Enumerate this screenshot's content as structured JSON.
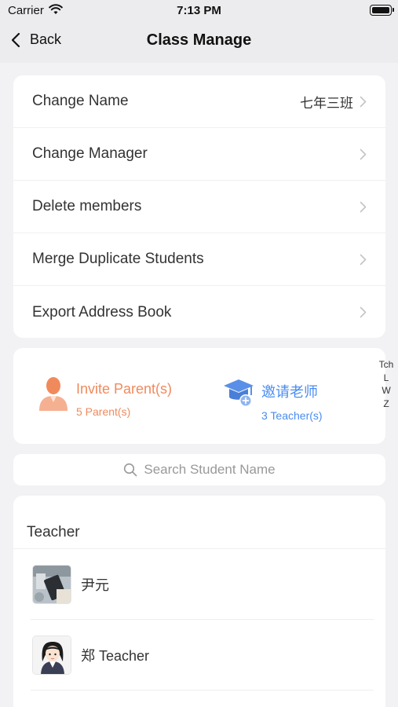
{
  "status_bar": {
    "carrier": "Carrier",
    "time": "7:13 PM"
  },
  "nav": {
    "back_label": "Back",
    "title": "Class Manage"
  },
  "menu": [
    {
      "label": "Change Name",
      "value": "七年三班"
    },
    {
      "label": "Change Manager",
      "value": ""
    },
    {
      "label": "Delete members",
      "value": ""
    },
    {
      "label": "Merge Duplicate Students",
      "value": ""
    },
    {
      "label": "Export Address Book",
      "value": ""
    }
  ],
  "invite": {
    "parent": {
      "label": "Invite Parent(s)",
      "count": "5 Parent(s)",
      "color": "#f08a5d",
      "icon": "parent-person-icon"
    },
    "teacher": {
      "label": "邀请老师",
      "count": "3 Teacher(s)",
      "color": "#4a8cf0",
      "icon": "graduation-cap-add-icon"
    }
  },
  "index_bar": [
    "Tch",
    "L",
    "W",
    "Z"
  ],
  "search": {
    "placeholder": "Search Student Name"
  },
  "teacher_section": {
    "header": "Teacher",
    "members": [
      {
        "name": "尹元",
        "avatar": "photo-avatar"
      },
      {
        "name": "郑 Teacher",
        "avatar": "cartoon-girl-avatar"
      }
    ]
  }
}
